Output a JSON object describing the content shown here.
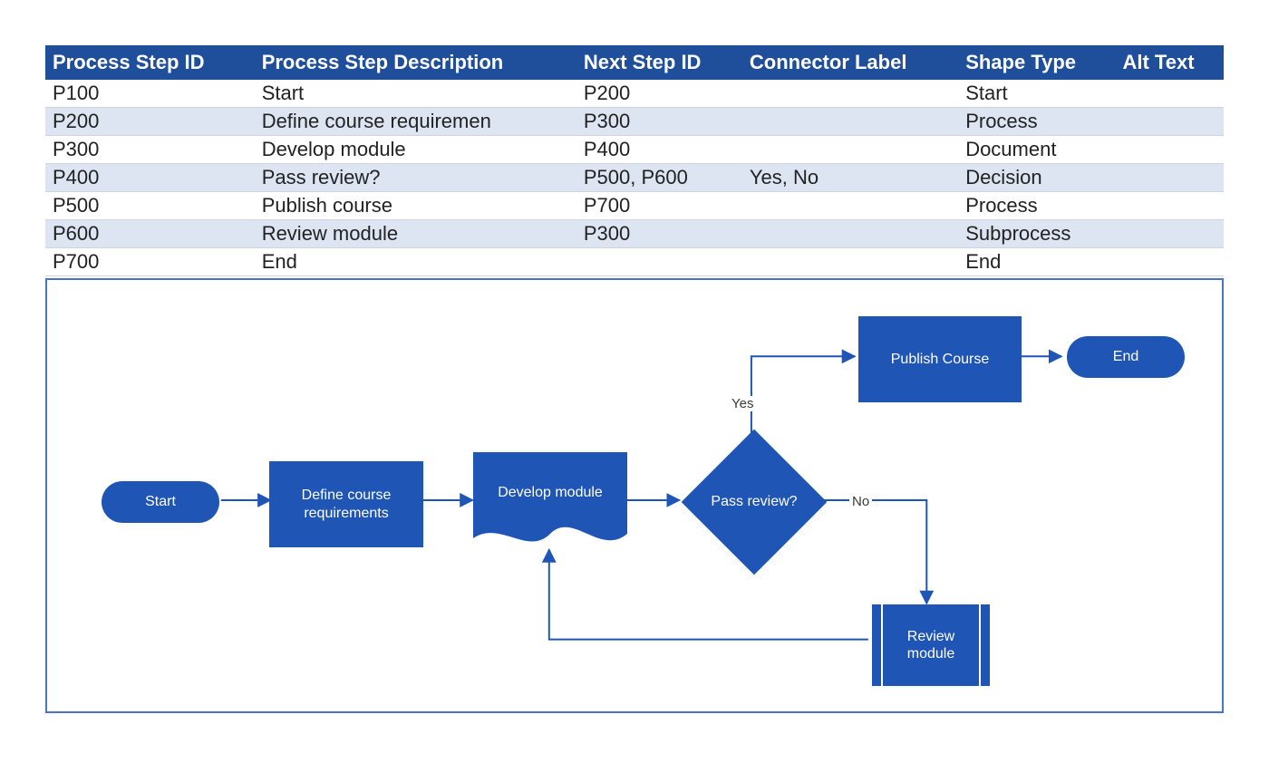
{
  "table": {
    "headers": [
      "Process Step ID",
      "Process Step Description",
      "Next Step ID",
      "Connector Label",
      "Shape Type",
      "Alt Text"
    ],
    "rows": [
      {
        "id": "P100",
        "desc": "Start",
        "next": "P200",
        "conn": "",
        "shape": "Start",
        "alt": ""
      },
      {
        "id": "P200",
        "desc": "Define course requiremen",
        "next": "P300",
        "conn": "",
        "shape": "Process",
        "alt": ""
      },
      {
        "id": "P300",
        "desc": "Develop module",
        "next": "P400",
        "conn": "",
        "shape": "Document",
        "alt": ""
      },
      {
        "id": "P400",
        "desc": "Pass review?",
        "next": "P500, P600",
        "conn": "Yes, No",
        "shape": "Decision",
        "alt": ""
      },
      {
        "id": "P500",
        "desc": "Publish course",
        "next": "P700",
        "conn": "",
        "shape": "Process",
        "alt": ""
      },
      {
        "id": "P600",
        "desc": "Review module",
        "next": "P300",
        "conn": "",
        "shape": "Subprocess",
        "alt": ""
      },
      {
        "id": "P700",
        "desc": "End",
        "next": "",
        "conn": "",
        "shape": "End",
        "alt": ""
      }
    ]
  },
  "flow": {
    "start": "Start",
    "define": "Define course requirements",
    "develop": "Develop module",
    "decision": "Pass review?",
    "publish": "Publish Course",
    "end": "End",
    "review": "Review module",
    "yes": "Yes",
    "no": "No"
  },
  "colors": {
    "header": "#1f4e9b",
    "band": "#dde5f3",
    "shape": "#1f55b5",
    "border": "#4a73c7"
  }
}
